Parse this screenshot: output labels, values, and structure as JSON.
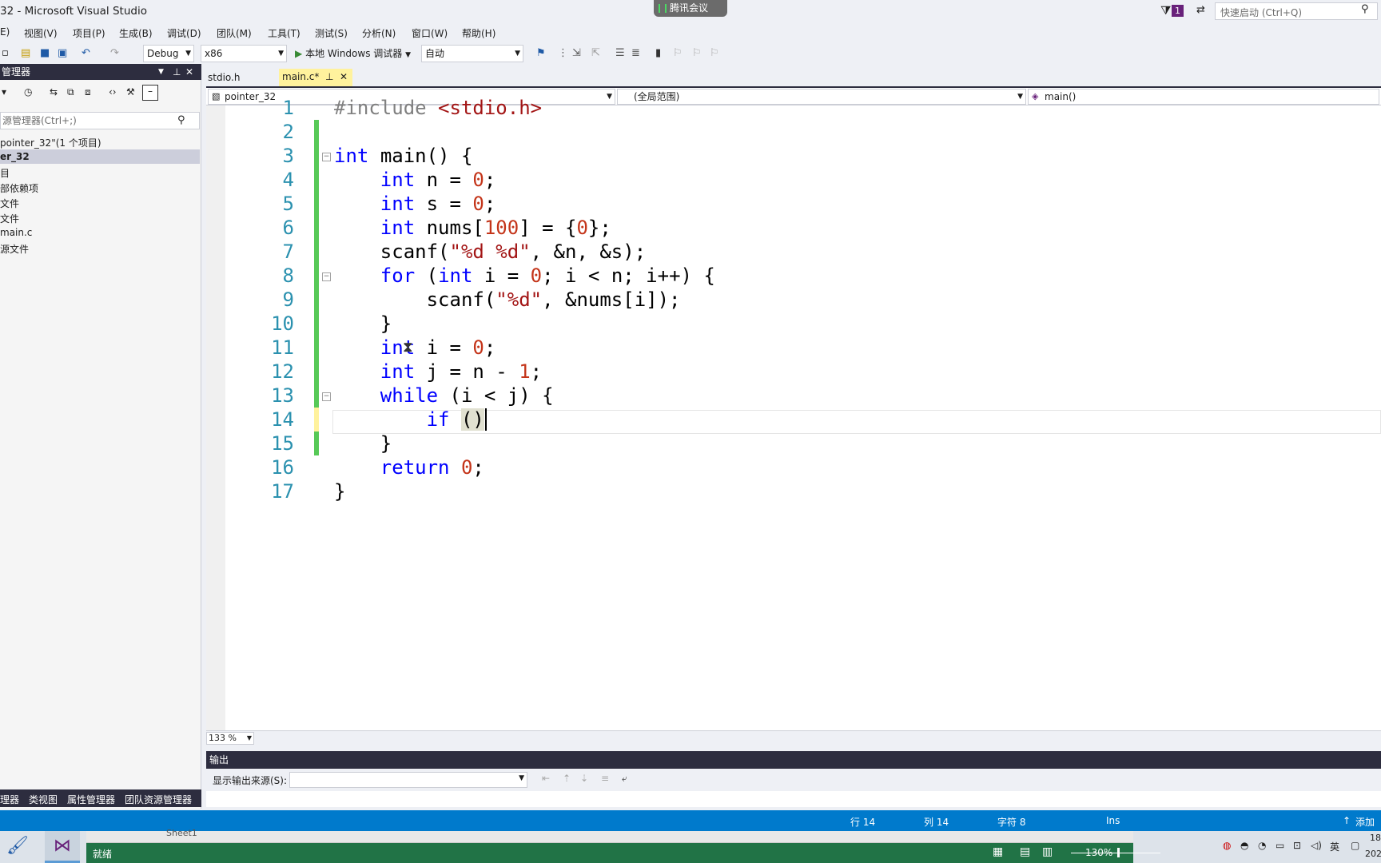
{
  "window": {
    "title": "32 - Microsoft Visual Studio"
  },
  "meeting": {
    "label": "腾讯会议"
  },
  "notifications": {
    "count": "1"
  },
  "quick_launch": {
    "placeholder": "快速启动 (Ctrl+Q)"
  },
  "menu": [
    "E)",
    "视图(V)",
    "项目(P)",
    "生成(B)",
    "调试(D)",
    "团队(M)",
    "工具(T)",
    "测试(S)",
    "分析(N)",
    "窗口(W)",
    "帮助(H)"
  ],
  "toolbar": {
    "config": "Debug",
    "platform": "x86",
    "run_label": "本地 Windows 调试器",
    "run_mode": "自动"
  },
  "solution_explorer": {
    "title": "管理器",
    "search_placeholder": "源管理器(Ctrl+;)",
    "items": [
      "pointer_32\"(1 个项目)",
      "er_32",
      "目",
      "部依赖项",
      "文件",
      "文件",
      "main.c",
      "源文件"
    ],
    "bottom_tabs": [
      "理器",
      "类视图",
      "属性管理器",
      "团队资源管理器"
    ]
  },
  "tabs": [
    {
      "label": "stdio.h"
    },
    {
      "label": "main.c*"
    }
  ],
  "nav": {
    "project": "pointer_32",
    "scope": "(全局范围)",
    "member": "main()"
  },
  "code": {
    "line_numbers": [
      "1",
      "2",
      "3",
      "4",
      "5",
      "6",
      "7",
      "8",
      "9",
      "10",
      "11",
      "12",
      "13",
      "14",
      "15",
      "16",
      "17"
    ]
  },
  "zoom": {
    "level": "133 %"
  },
  "output": {
    "title": "输出",
    "source_label": "显示输出来源(S):"
  },
  "status": {
    "ready": "就绪",
    "line": "行 14",
    "col": "列 14",
    "char": "字符 8",
    "mode": "Ins",
    "publish": "添加到"
  },
  "excel": {
    "zoom": "130%",
    "sheet": "Sheet1"
  },
  "tray": {
    "ime": "英",
    "time": "18",
    "date": "202"
  },
  "colors": {
    "accent": "#007acc",
    "dark_panel": "#2d2d3f",
    "change_green": "#57c957",
    "change_yellow": "#fff29d"
  }
}
